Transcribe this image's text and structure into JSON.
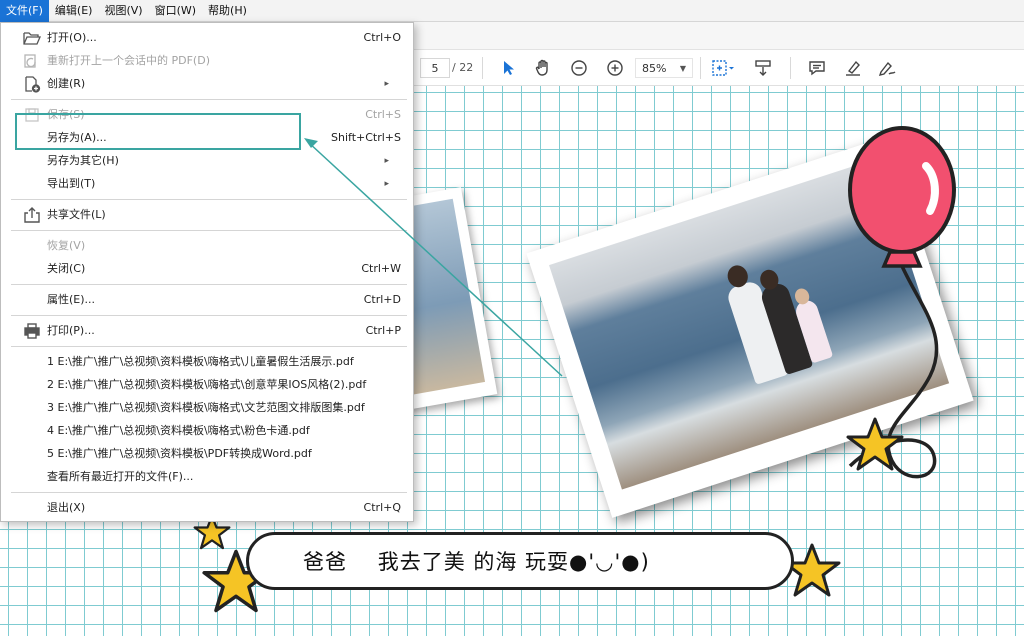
{
  "menubar": {
    "items": [
      "文件(F)",
      "编辑(E)",
      "视图(V)",
      "窗口(W)",
      "帮助(H)"
    ]
  },
  "toolbar": {
    "page_current": "5",
    "page_total": "/ 22",
    "zoom": "85%",
    "icons": [
      "select-arrow-icon",
      "hand-icon",
      "zoom-out-icon",
      "zoom-in-icon",
      "page-fit-icon",
      "scroll-mode-icon",
      "comment-icon",
      "highlight-icon",
      "sign-icon"
    ]
  },
  "menu": {
    "open": {
      "label": "打开(O)...",
      "shortcut": "Ctrl+O"
    },
    "reopen": {
      "label": "重新打开上一个会话中的 PDF(D)"
    },
    "create": {
      "label": "创建(R)"
    },
    "save": {
      "label": "保存(S)",
      "shortcut": "Ctrl+S"
    },
    "saveas": {
      "label": "另存为(A)...",
      "shortcut": "Shift+Ctrl+S"
    },
    "saveother": {
      "label": "另存为其它(H)"
    },
    "export": {
      "label": "导出到(T)"
    },
    "share": {
      "label": "共享文件(L)"
    },
    "restore": {
      "label": "恢复(V)"
    },
    "close": {
      "label": "关闭(C)",
      "shortcut": "Ctrl+W"
    },
    "props": {
      "label": "属性(E)...",
      "shortcut": "Ctrl+D"
    },
    "print": {
      "label": "打印(P)...",
      "shortcut": "Ctrl+P"
    },
    "recent": [
      "1 E:\\推广\\推广\\总视频\\资料模板\\嗨格式\\儿童暑假生活展示.pdf",
      "2 E:\\推广\\推广\\总视频\\资料模板\\嗨格式\\创意苹果IOS风格(2).pdf",
      "3 E:\\推广\\推广\\总视频\\资料模板\\嗨格式\\文艺范图文排版图集.pdf",
      "4 E:\\推广\\推广\\总视频\\资料模板\\嗨格式\\粉色卡通.pdf",
      "5 E:\\推广\\推广\\总视频\\资料模板\\PDF转换成Word.pdf"
    ],
    "viewall": {
      "label": "查看所有最近打开的文件(F)..."
    },
    "exit": {
      "label": "退出(X)",
      "shortcut": "Ctrl+Q"
    }
  },
  "document": {
    "caption": "爸爸    我去了美 的海 玩耍●'◡'●)"
  },
  "colors": {
    "accent": "#1a73d6",
    "highlight_box": "#3aa5a1",
    "grid": "#7fcbd1",
    "balloon": "#f2506f",
    "star": "#f5c425"
  }
}
